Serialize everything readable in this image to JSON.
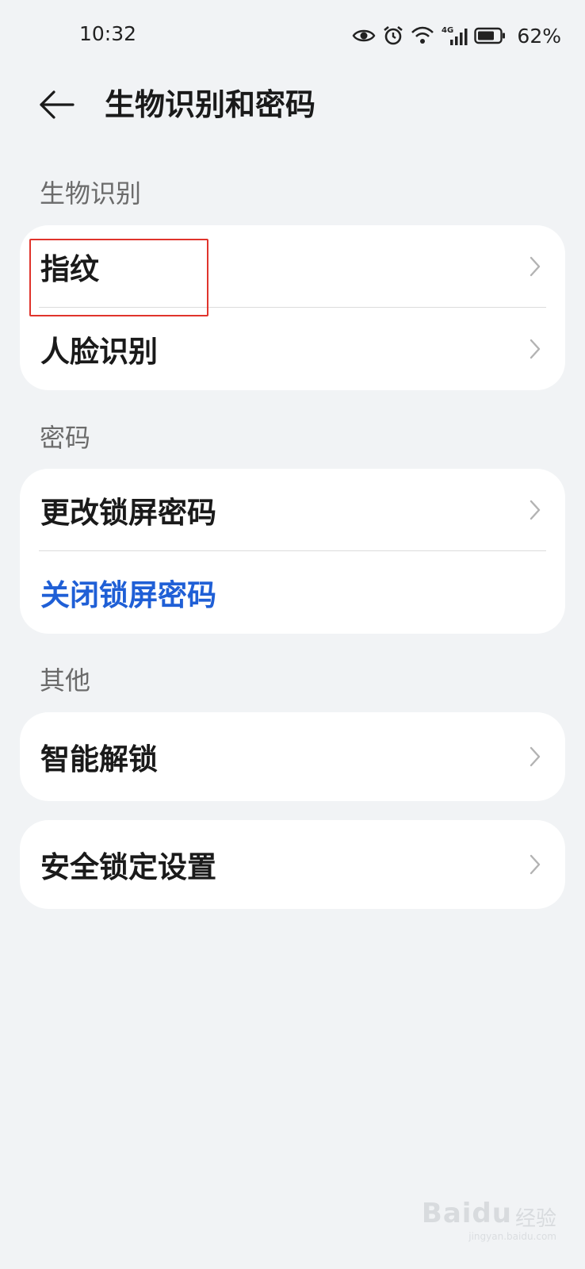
{
  "status_bar": {
    "time": "10:32",
    "network": "4G",
    "battery_percent": "62%",
    "icons": [
      "eye-icon",
      "alarm-icon",
      "wifi-icon",
      "signal-icon",
      "battery-icon"
    ]
  },
  "header": {
    "title": "生物识别和密码",
    "back_icon": "back-arrow-icon"
  },
  "sections": [
    {
      "label": "生物识别",
      "items": [
        {
          "label": "指纹",
          "chevron": true
        },
        {
          "label": "人脸识别",
          "chevron": true
        }
      ]
    },
    {
      "label": "密码",
      "items": [
        {
          "label": "更改锁屏密码",
          "chevron": true
        },
        {
          "label": "关闭锁屏密码",
          "chevron": false,
          "style": "link"
        }
      ]
    },
    {
      "label": "其他",
      "items": [
        {
          "label": "智能解锁",
          "chevron": true
        }
      ]
    },
    {
      "label": "",
      "items": [
        {
          "label": "安全锁定设置",
          "chevron": true
        }
      ]
    }
  ],
  "colors": {
    "background": "#f1f3f5",
    "card": "#ffffff",
    "link": "#1f5fd6",
    "highlight": "#e0342c"
  },
  "watermark": {
    "brand": "Baidu",
    "suffix": "经验",
    "url": "jingyan.baidu.com"
  }
}
